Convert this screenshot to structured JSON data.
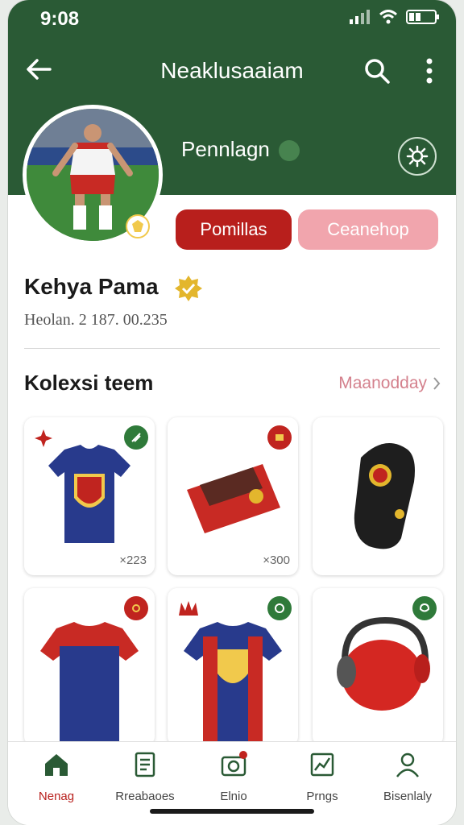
{
  "status_bar": {
    "time": "9:08"
  },
  "app_bar": {
    "title": "Neaklusaaiam"
  },
  "profile": {
    "handle": "Pennlagn",
    "primary_button": "Pomillas",
    "secondary_button": "Ceanehop",
    "display_name": "Kehya Pama",
    "stats": "Heolan. 2 187. 00.235"
  },
  "collection": {
    "title": "Kolexsi teem",
    "link": "Maanodday",
    "items": [
      {
        "name": "blue-jersey",
        "price": "×223",
        "badge_color": "#2f7a3a"
      },
      {
        "name": "red-wallet",
        "price": "×300",
        "badge_color": "#c0241f"
      },
      {
        "name": "black-band",
        "price": "",
        "badge_color": ""
      },
      {
        "name": "red-blue-jersey",
        "price": "",
        "badge_color": "#c0241f"
      },
      {
        "name": "striped-jersey",
        "price": "",
        "badge_color": "#2f7a3a"
      },
      {
        "name": "red-headphones",
        "price": "",
        "badge_color": "#2f7a3a"
      }
    ]
  },
  "bottom_nav": [
    {
      "label": "Nenag",
      "icon": "home-icon",
      "active": true
    },
    {
      "label": "Rreabaoes",
      "icon": "document-list-icon",
      "active": false
    },
    {
      "label": "Elnio",
      "icon": "camera-icon",
      "active": false
    },
    {
      "label": "Prngs",
      "icon": "chart-icon",
      "active": false
    },
    {
      "label": "Bisenlaly",
      "icon": "person-icon",
      "active": false
    }
  ],
  "colors": {
    "header": "#2a5a35",
    "accent": "#b81f1c",
    "secondary": "#f1a5ad",
    "link": "#d4818d"
  }
}
